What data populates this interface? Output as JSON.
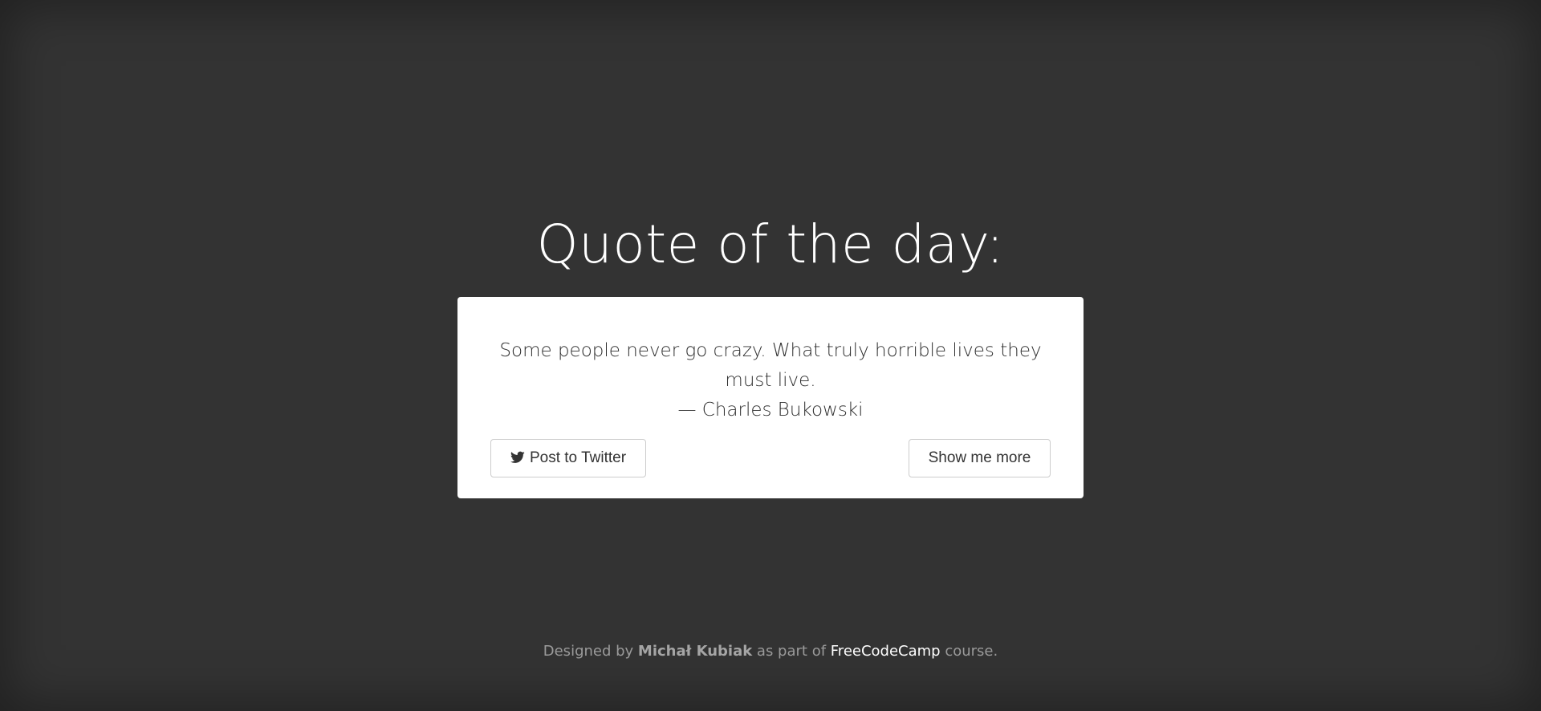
{
  "page": {
    "title": "Quote of the day:",
    "background_color": "#333333"
  },
  "quote": {
    "text": "Some people never go crazy. What truly horrible lives they must live.",
    "author": "— Charles Bukowski"
  },
  "buttons": {
    "twitter_label": "Post to Twitter",
    "twitter_icon": "twitter-bird-icon",
    "more_label": "Show me more"
  },
  "footer": {
    "prefix": "Designed by ",
    "author": "Michał Kubiak",
    "middle": " as part of ",
    "link_text": "FreeCodeCamp",
    "suffix": " course."
  }
}
